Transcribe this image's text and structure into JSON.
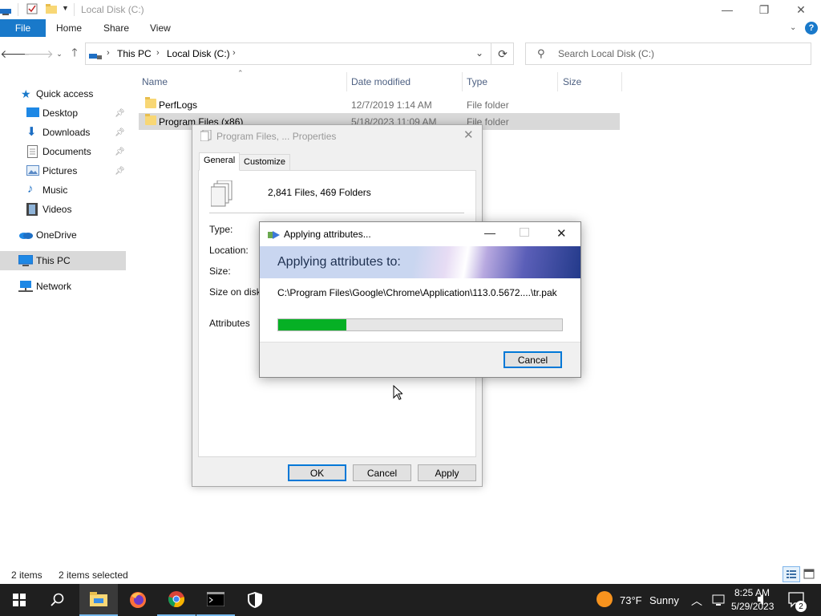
{
  "window": {
    "title": "Local Disk (C:)",
    "minimize": "—",
    "maximize": "❐",
    "close": "✕"
  },
  "ribbon": {
    "file": "File",
    "tabs": [
      "Home",
      "Share",
      "View"
    ],
    "help": "?"
  },
  "address": {
    "crumbs": [
      "This PC",
      "Local Disk (C:)"
    ],
    "search_placeholder": "Search Local Disk (C:)"
  },
  "nav": {
    "items": [
      {
        "label": "Quick access",
        "icon": "star-icon"
      },
      {
        "label": "Desktop",
        "icon": "desktop-icon",
        "pinned": true
      },
      {
        "label": "Downloads",
        "icon": "download-icon",
        "pinned": true
      },
      {
        "label": "Documents",
        "icon": "documents-icon",
        "pinned": true
      },
      {
        "label": "Pictures",
        "icon": "pictures-icon",
        "pinned": true
      },
      {
        "label": "Music",
        "icon": "music-icon"
      },
      {
        "label": "Videos",
        "icon": "videos-icon"
      },
      {
        "label": "OneDrive",
        "icon": "onedrive-icon"
      },
      {
        "label": "This PC",
        "icon": "pc-icon",
        "selected": true
      },
      {
        "label": "Network",
        "icon": "network-icon"
      }
    ]
  },
  "columns": [
    "Name",
    "Date modified",
    "Type",
    "Size"
  ],
  "files": [
    {
      "name": "PerfLogs",
      "date": "12/7/2019 1:14 AM",
      "type": "File folder",
      "size": ""
    },
    {
      "name": "Program Files (x86)",
      "date": "5/18/2023 11:09 AM",
      "type": "File folder",
      "size": ""
    }
  ],
  "status": {
    "items": "2 items",
    "selected": "2 items selected"
  },
  "properties": {
    "title": "Program Files, ... Properties",
    "tabs": [
      "General",
      "Customize"
    ],
    "summary": "2,841 Files, 469 Folders",
    "labels": [
      "Type:",
      "Location:",
      "Size:",
      "Size on disk:",
      "Attributes"
    ],
    "ok": "OK",
    "cancel": "Cancel",
    "apply": "Apply"
  },
  "applying": {
    "title": "Applying attributes...",
    "heading": "Applying attributes to:",
    "path": "C:\\Program Files\\Google\\Chrome\\Application\\113.0.5672....\\tr.pak",
    "progress_percent": 24,
    "cancel": "Cancel"
  },
  "taskbar": {
    "weather_temp": "73°F",
    "weather_text": "Sunny",
    "time": "8:25 AM",
    "date": "5/29/2023",
    "notifications": "2"
  },
  "colors": {
    "accent": "#1979ca",
    "progress": "#06b025",
    "selection": "#cce8ff",
    "selected_row": "#d9d9d9",
    "taskbar": "#1f1f1f"
  }
}
